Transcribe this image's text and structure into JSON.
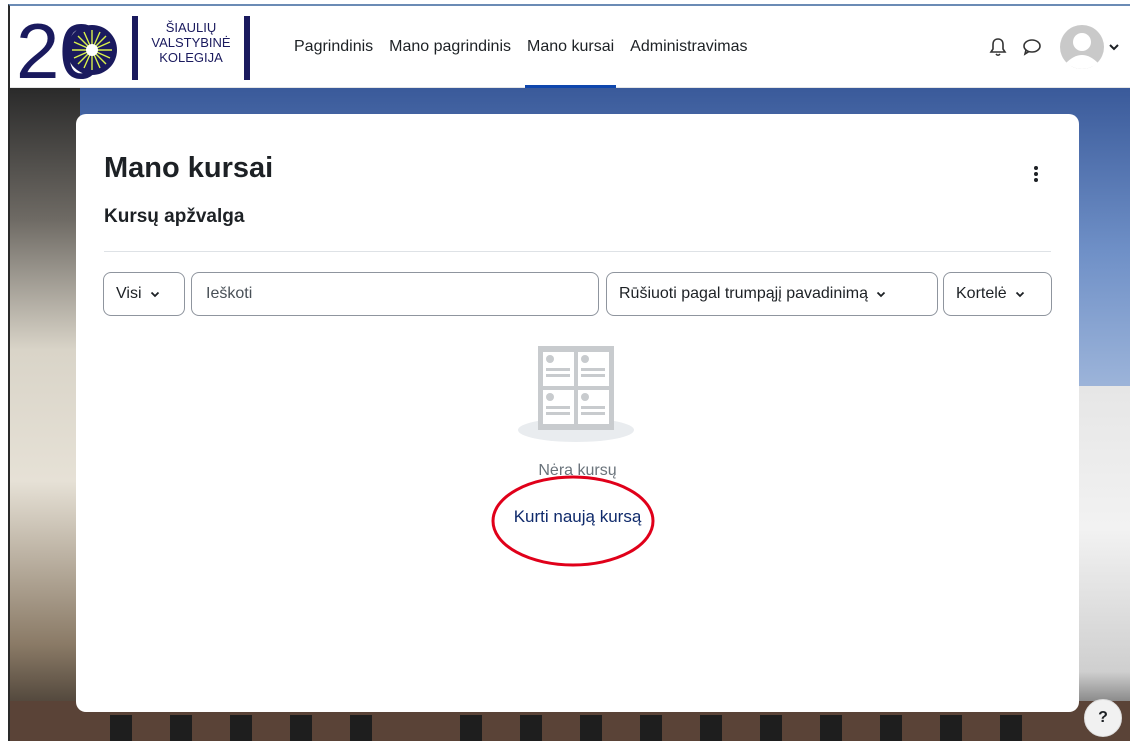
{
  "logo": {
    "number": "20",
    "line1": "ŠIAULIŲ",
    "line2": "VALSTYBINĖ",
    "line3": "KOLEGIJA"
  },
  "nav": {
    "items": [
      {
        "label": "Pagrindinis",
        "active": false
      },
      {
        "label": "Mano pagrindinis",
        "active": false
      },
      {
        "label": "Mano kursai",
        "active": true
      },
      {
        "label": "Administravimas",
        "active": false
      }
    ],
    "icons": [
      "bell-icon",
      "chat-bubble-icon",
      "user-avatar-icon",
      "chevron-down-icon"
    ]
  },
  "page": {
    "title": "Mano kursai",
    "section": "Kursų apžvalga"
  },
  "filters": {
    "grouping": "Visi",
    "search_placeholder": "Ieškoti",
    "sort": "Rūšiuoti pagal trumpąjį pavadinimą",
    "view": "Kortelė"
  },
  "empty_state": {
    "message": "Nėra kursų",
    "create_link": "Kurti naują kursą"
  },
  "help": {
    "label": "?"
  },
  "colors": {
    "accent": "#0f47ad",
    "link": "#0f2a6b",
    "highlight_circle": "#e0001a"
  }
}
